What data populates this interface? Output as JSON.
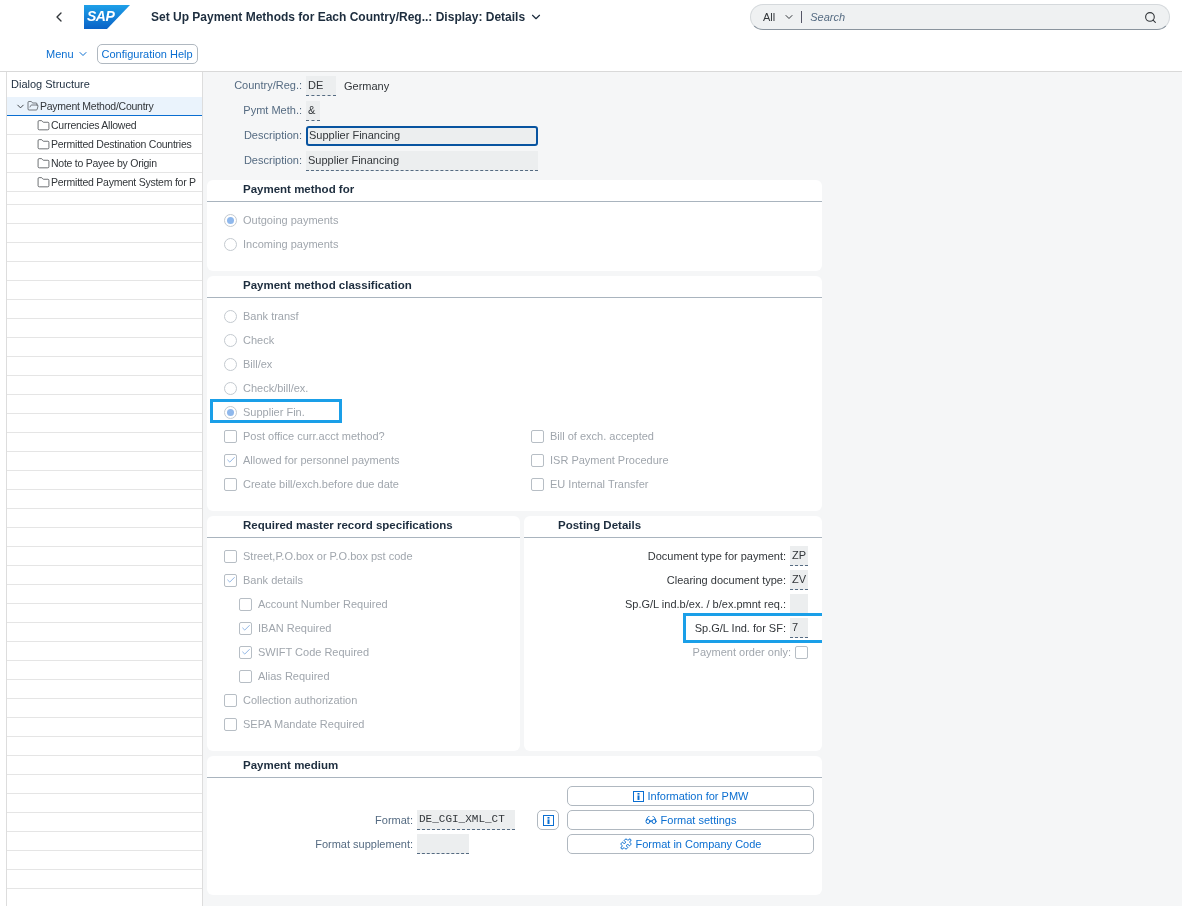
{
  "header": {
    "logo": "SAP",
    "title": "Set Up Payment Methods for Each Country/Reg..: Display: Details",
    "search": {
      "scope": "All",
      "placeholder": "Search"
    }
  },
  "toolbar": {
    "menu": "Menu",
    "buttons": [
      "Configuration Help"
    ]
  },
  "dialog_structure": {
    "title": "Dialog Structure",
    "tree": [
      {
        "label": "Payment Method/Country",
        "expanded": true,
        "selected": true,
        "children": [
          {
            "label": "Currencies Allowed",
            "selected": false
          },
          {
            "label": "Permitted Destination Countries",
            "selected": false
          },
          {
            "label": "Note to Payee by Origin",
            "selected": false
          },
          {
            "label": "Permitted Payment System for P",
            "selected": false
          }
        ]
      }
    ]
  },
  "header_fields": [
    {
      "label": "Country/Reg.:",
      "value": "DE",
      "text": "Germany",
      "focused": false
    },
    {
      "label": "Pymt Meth.:",
      "value": "&",
      "focused": false
    },
    {
      "label": "Description:",
      "value": "Supplier Financing",
      "focused": true
    },
    {
      "label": "Description:",
      "value": "Supplier Financing",
      "focused": false
    }
  ],
  "payment_method_for": {
    "title": "Payment method for",
    "options": [
      {
        "label": "Outgoing payments",
        "selected": true
      },
      {
        "label": "Incoming payments",
        "selected": false
      }
    ]
  },
  "classification": {
    "title": "Payment method classification",
    "options": [
      {
        "label": "Bank transf",
        "selected": false,
        "highlighted": false
      },
      {
        "label": "Check",
        "selected": false,
        "highlighted": false
      },
      {
        "label": "Bill/ex",
        "selected": false,
        "highlighted": false
      },
      {
        "label": "Check/bill/ex.",
        "selected": false,
        "highlighted": false
      },
      {
        "label": "Supplier Fin.",
        "selected": true,
        "highlighted": true
      }
    ],
    "checks_left": [
      {
        "label": "Post office curr.acct method?",
        "checked": false
      },
      {
        "label": "Allowed for personnel payments",
        "checked": true
      },
      {
        "label": "Create bill/exch.before due date",
        "checked": false
      }
    ],
    "checks_right": [
      {
        "label": "Bill of exch. accepted",
        "checked": false
      },
      {
        "label": "ISR Payment Procedure",
        "checked": false
      },
      {
        "label": "EU Internal Transfer",
        "checked": false
      }
    ]
  },
  "master_record": {
    "title": "Required master record specifications",
    "checks": [
      {
        "label": "Street,P.O.box or P.O.box pst code",
        "checked": false
      },
      {
        "label": "Bank details",
        "checked": true,
        "children": [
          {
            "label": "Account Number Required",
            "checked": false
          },
          {
            "label": "IBAN Required",
            "checked": true
          },
          {
            "label": "SWIFT Code Required",
            "checked": true
          },
          {
            "label": "Alias Required",
            "checked": false
          }
        ]
      },
      {
        "label": "Collection authorization",
        "checked": false
      },
      {
        "label": "SEPA Mandate Required",
        "checked": false
      }
    ]
  },
  "posting_details": {
    "title": "Posting Details",
    "rows": [
      {
        "kind": "field",
        "label": "Document type for payment:",
        "value": "ZP",
        "highlighted": false
      },
      {
        "kind": "field",
        "label": "Clearing document type:",
        "value": "ZV",
        "highlighted": false
      },
      {
        "kind": "field",
        "label": "Sp.G/L ind.b/ex. / b/ex.pmnt req.:",
        "highlighted": false
      },
      {
        "kind": "field",
        "label": "Sp.G/L Ind. for SF:",
        "value": "7",
        "highlighted": true
      },
      {
        "kind": "checkbox",
        "label": "Payment order only:",
        "checked": false,
        "highlighted": false
      }
    ]
  },
  "payment_medium": {
    "title": "Payment medium",
    "fields": [
      {
        "label": "Format:",
        "value": "DE_CGI_XML_CT"
      },
      {
        "label": "Format supplement:"
      }
    ],
    "buttons": [
      "Information for PMW",
      "Format settings",
      "Format in Company Code"
    ]
  }
}
